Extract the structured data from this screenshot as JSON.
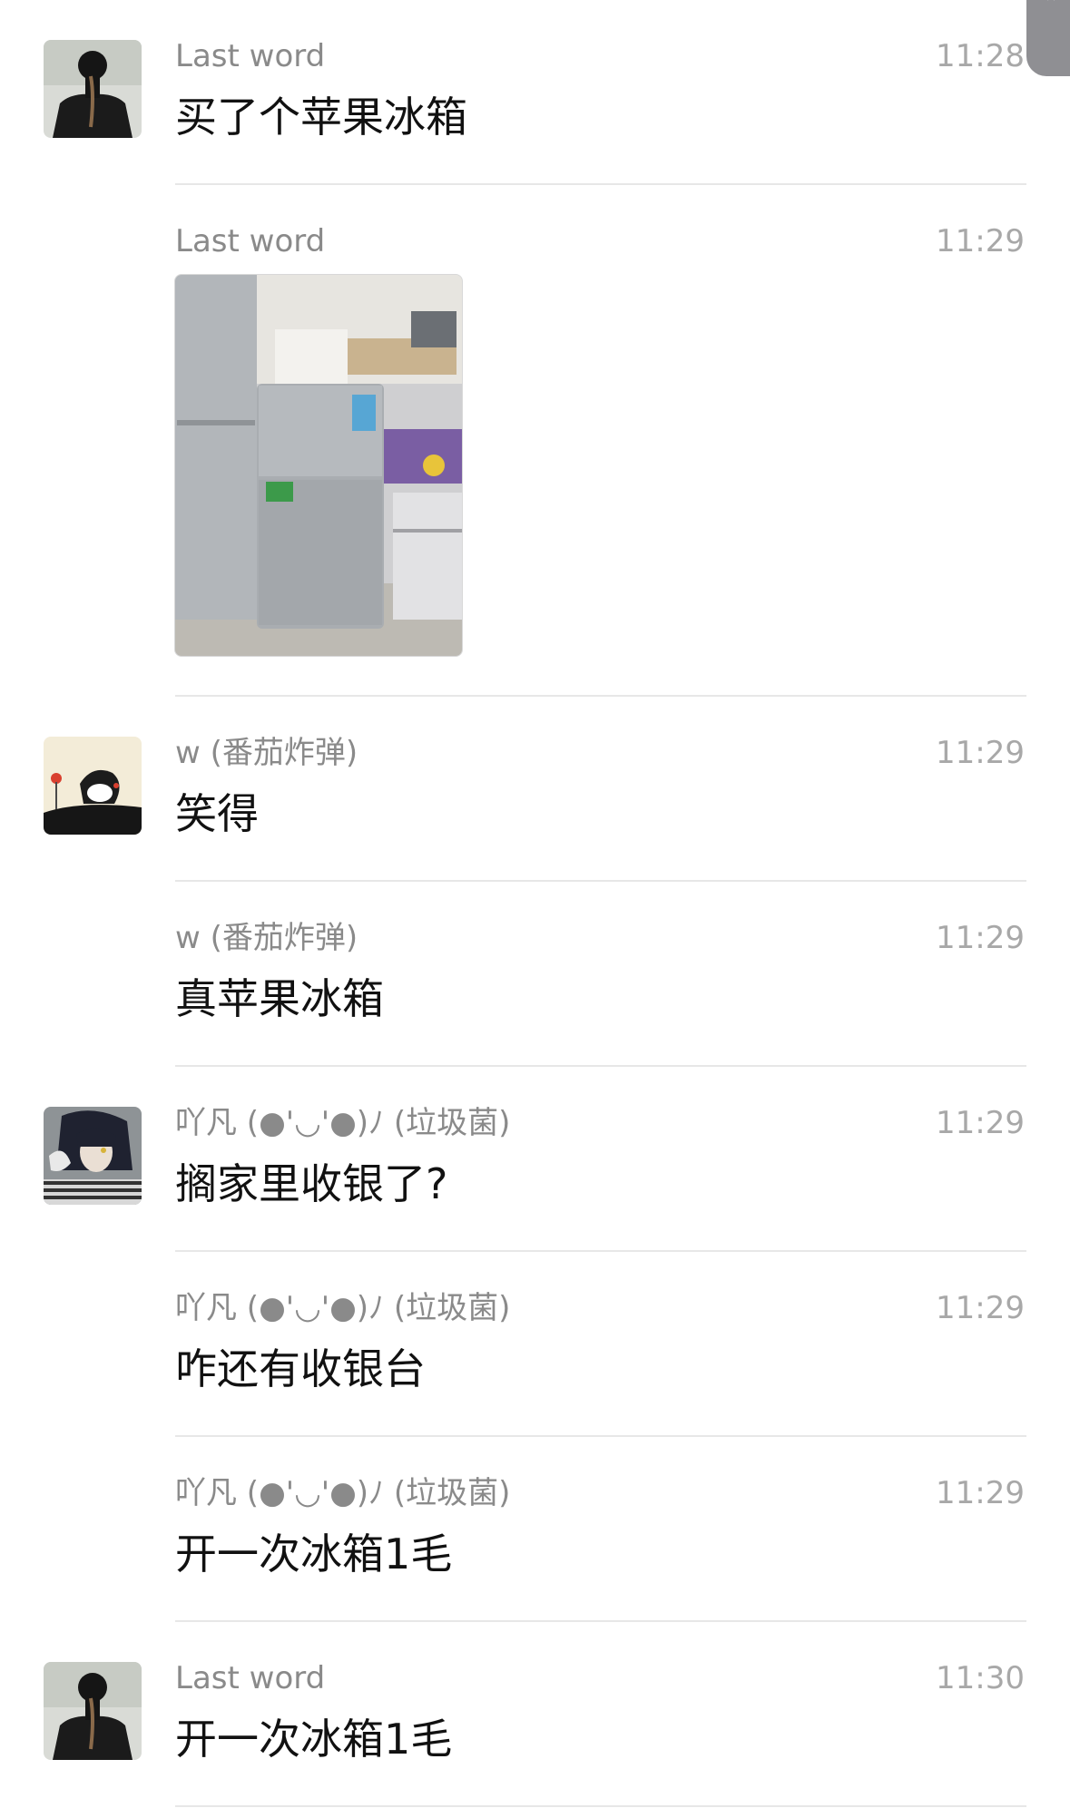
{
  "messages": [
    {
      "sender": "Last word",
      "time": "11:28",
      "text": "买了个苹果冰箱",
      "avatar": "avatar-dark-figure"
    },
    {
      "sender": "Last word",
      "time": "11:29",
      "image": "photo-of-fridge"
    },
    {
      "sender": "w (番茄炸弹)",
      "time": "11:29",
      "text": "笑得",
      "avatar": "avatar-cartoon-penguin"
    },
    {
      "sender": "w (番茄炸弹)",
      "time": "11:29",
      "text": "真苹果冰箱"
    },
    {
      "sender": "吖凡 (●'◡'●)ﾉ (垃圾菌)",
      "time": "11:29",
      "text": "搁家里收银了?",
      "avatar": "avatar-anime-character"
    },
    {
      "sender": "吖凡 (●'◡'●)ﾉ (垃圾菌)",
      "time": "11:29",
      "text": "咋还有收银台"
    },
    {
      "sender": "吖凡 (●'◡'●)ﾉ (垃圾菌)",
      "time": "11:29",
      "text": "开一次冰箱1毛"
    },
    {
      "sender": "Last word",
      "time": "11:30",
      "text": "开一次冰箱1毛",
      "avatar": "avatar-dark-figure"
    }
  ]
}
